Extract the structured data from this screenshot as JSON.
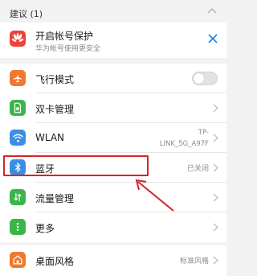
{
  "suggestions": {
    "header": "建议 (1)",
    "item": {
      "title": "开启帐号保护",
      "subtitle": "华为帐号使用更安全",
      "icon": "huawei-logo-icon"
    }
  },
  "settings": [
    {
      "id": "airplane",
      "label": "飞行模式",
      "icon": "airplane-icon",
      "icon_color": "#f0792e",
      "control": "toggle",
      "toggle_on": false
    },
    {
      "id": "dual-sim",
      "label": "双卡管理",
      "icon": "sim-card-icon",
      "icon_color": "#3bb54a",
      "control": "chevron"
    },
    {
      "id": "wlan",
      "label": "WLAN",
      "icon": "wifi-icon",
      "icon_color": "#3a8ee6",
      "control": "chevron",
      "value_line1": "TP-",
      "value_line2": "LINK_5G_A97F"
    },
    {
      "id": "bluetooth",
      "label": "蓝牙",
      "icon": "bluetooth-icon",
      "icon_color": "#3a8ee6",
      "control": "chevron",
      "value": "已关闭"
    },
    {
      "id": "data",
      "label": "流量管理",
      "icon": "data-usage-icon",
      "icon_color": "#3bb54a",
      "control": "chevron"
    },
    {
      "id": "more",
      "label": "更多",
      "icon": "more-icon",
      "icon_color": "#3bb54a",
      "control": "chevron"
    },
    {
      "id": "theme",
      "label": "桌面风格",
      "icon": "home-icon",
      "icon_color": "#f0792e",
      "control": "chevron",
      "value": "标准风格"
    }
  ],
  "colors": {
    "highlight": "#d8232a",
    "accent_blue": "#1d7ff0"
  }
}
